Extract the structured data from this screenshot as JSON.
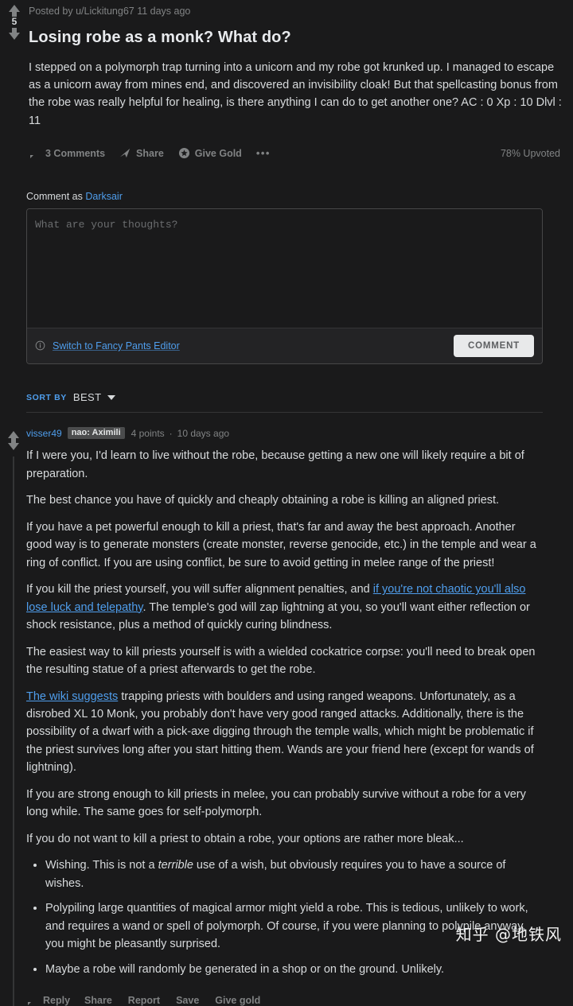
{
  "post": {
    "score": "5",
    "meta": "Posted by u/Lickitung67 11 days ago",
    "title": "Losing robe as a monk? What do?",
    "body": "I stepped on a polymorph trap turning into a unicorn and my robe got krunked up. I managed to escape as a unicorn away from mines end, and discovered an invisibility cloak! But that spellcasting bonus from the robe was really helpful for healing, is there anything I can do to get another one? AC : 0 Xp : 10 Dlvl : 11",
    "actions": {
      "comments": "3 Comments",
      "share": "Share",
      "give_gold": "Give Gold",
      "more": "•••"
    },
    "upvoted": "78% Upvoted"
  },
  "composer": {
    "comment_as_prefix": "Comment as ",
    "comment_as_user": "Darksair",
    "placeholder": "What are your thoughts?",
    "switch_editor": "Switch to Fancy Pants Editor",
    "submit": "COMMENT"
  },
  "sort": {
    "label": "SORT BY",
    "value": "BEST"
  },
  "comment": {
    "author": "visser49",
    "flair": "nao: Aximili",
    "points": "4 points",
    "dot": "·",
    "time": "10 days ago",
    "paragraphs": {
      "p1": "If I were you, I'd learn to live without the robe, because getting a new one will likely require a bit of preparation.",
      "p2": "The best chance you have of quickly and cheaply obtaining a robe is killing an aligned priest.",
      "p3": "If you have a pet powerful enough to kill a priest, that's far and away the best approach. Another good way is to generate monsters (create monster, reverse genocide, etc.) in the temple and wear a ring of conflict. If you are using conflict, be sure to avoid getting in melee range of the priest!",
      "p4a": "If you kill the priest yourself, you will suffer alignment penalties, and ",
      "p4link": "if you're not chaotic you'll also lose luck and telepathy",
      "p4b": ". The temple's god will zap lightning at you, so you'll want either reflection or shock resistance, plus a method of quickly curing blindness.",
      "p5": "The easiest way to kill priests yourself is with a wielded cockatrice corpse: you'll need to break open the resulting statue of a priest afterwards to get the robe.",
      "p6link": "The wiki suggests",
      "p6": " trapping priests with boulders and using ranged weapons. Unfortunately, as a disrobed XL 10 Monk, you probably don't have very good ranged attacks. Additionally, there is the possibility of a dwarf with a pick-axe digging through the temple walls, which might be problematic if the priest survives long after you start hitting them. Wands are your friend here (except for wands of lightning).",
      "p7": "If you are strong enough to kill priests in melee, you can probably survive without a robe for a very long while. The same goes for self-polymorph.",
      "p8": "If you do not want to kill a priest to obtain a robe, your options are rather more bleak..."
    },
    "bullets": {
      "b1a": "Wishing. This is not a ",
      "b1em": "terrible",
      "b1b": " use of a wish, but obviously requires you to have a source of wishes.",
      "b2": "Polypiling large quantities of magical armor might yield a robe. This is tedious, unlikely to work, and requires a wand or spell of polymorph. Of course, if you were planning to polypile anyway, you might be pleasantly surprised.",
      "b3": "Maybe a robe will randomly be generated in a shop or on the ground. Unlikely."
    },
    "actions": {
      "reply": "Reply",
      "share": "Share",
      "report": "Report",
      "save": "Save",
      "give_gold": "Give gold"
    }
  },
  "watermark": "知乎 @地铁风",
  "colors": {
    "background": "#1a1a1b",
    "link": "#4f9eed",
    "text": "#d7dadc",
    "muted": "#818384",
    "flair_bg": "#4b4c4d",
    "button_bg": "#e8e9ea"
  }
}
